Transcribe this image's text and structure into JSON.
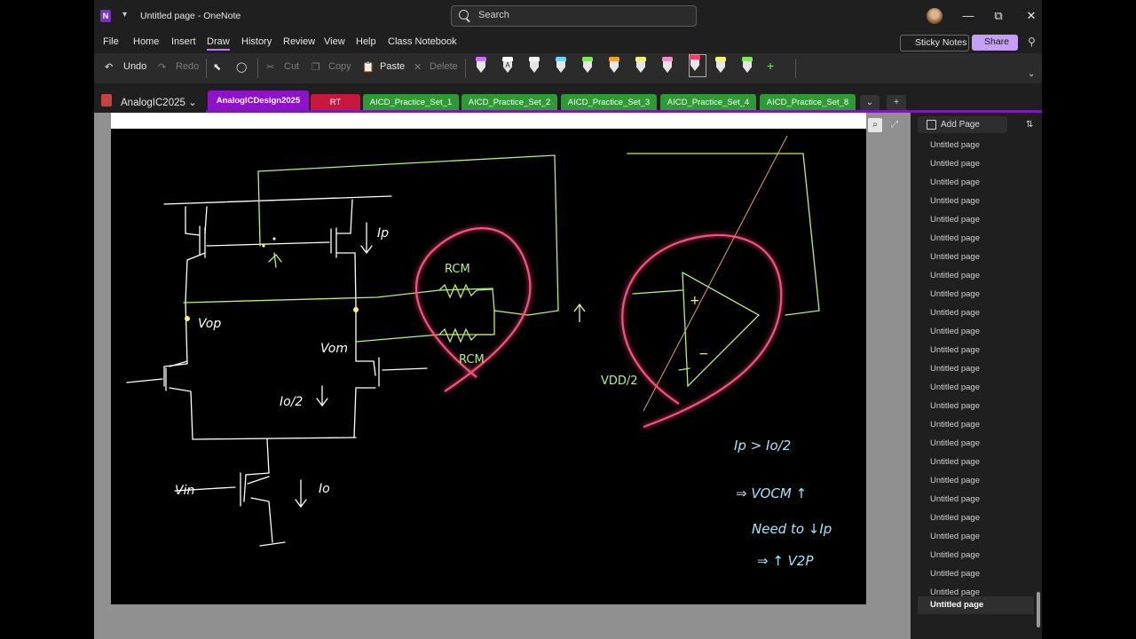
{
  "title_bar": {
    "app_icon_letter": "N",
    "document_title": "Untitled page  -  OneNote",
    "search_placeholder": "Search",
    "minimize": "—",
    "restore": "⧉",
    "close": "✕"
  },
  "menu": {
    "items": [
      "File",
      "Home",
      "Insert",
      "Draw",
      "History",
      "Review",
      "View",
      "Help",
      "Class Notebook"
    ],
    "active": "Draw",
    "sticky_notes": "Sticky Notes",
    "share": "Share"
  },
  "ribbon": {
    "undo": "Undo",
    "redo": "Redo",
    "cut": "Cut",
    "copy": "Copy",
    "paste": "Paste",
    "delete": "Delete",
    "pens": [
      {
        "color": "#c774ff"
      },
      {
        "color": "#ffffff",
        "letter": "A"
      },
      {
        "color": "#ffffff"
      },
      {
        "color": "#6fd7f5"
      },
      {
        "color": "#7be85a"
      },
      {
        "color": "#f0a030"
      },
      {
        "color": "#f5f27a"
      },
      {
        "color": "#f78bd0"
      },
      {
        "color": "#ff3b6a",
        "selected": true
      },
      {
        "color": "#f5f27a"
      },
      {
        "color": "#7be85a"
      }
    ],
    "add_pen": "+"
  },
  "notebook": {
    "name": "AnalogIC2025",
    "sections": [
      {
        "label": "AnalogICDesign2025",
        "color": "#8d12c9",
        "active": true
      },
      {
        "label": "RT",
        "color": "#c8173d"
      },
      {
        "label": "AICD_Practice_Set_1",
        "color": "#2e9a33"
      },
      {
        "label": "AICD_Practice_Set_2",
        "color": "#2e9a33"
      },
      {
        "label": "AICD_Practice_Set_3",
        "color": "#2e9a33"
      },
      {
        "label": "AICD_Practice_Set_4",
        "color": "#2e9a33"
      },
      {
        "label": "AICD_Practice_Set_8",
        "color": "#2e9a33"
      }
    ],
    "add_section": "+"
  },
  "pages": {
    "add_page": "Add Page",
    "items": [
      "Untitled page",
      "Untitled page",
      "Untitled page",
      "Untitled page",
      "Untitled page",
      "Untitled page",
      "Untitled page",
      "Untitled page",
      "Untitled page",
      "Untitled page",
      "Untitled page",
      "Untitled page",
      "Untitled page",
      "Untitled page",
      "Untitled page",
      "Untitled page",
      "Untitled page",
      "Untitled page",
      "Untitled page",
      "Untitled page",
      "Untitled page",
      "Untitled page",
      "Untitled page",
      "Untitled page",
      "Untitled page",
      "Untitled page"
    ],
    "current": "Untitled page"
  },
  "ink": {
    "ip": "Ip",
    "vop": "Vop",
    "vom": "Vom",
    "rcm_top": "RCM",
    "rcm_bottom": "RCM",
    "io_half": "Io/2",
    "vin": "Vin",
    "io": "Io",
    "vdd_half": "VDD/2",
    "opamp_plus": "+",
    "opamp_minus": "−",
    "note_1": "Ip > Io/2",
    "note_2": "⇒ VOCM ↑",
    "note_3": "Need to ↓Ip",
    "note_4": "⇒ ↑ V2P"
  },
  "colors": {
    "ink_white": "#ffffff",
    "ink_green": "#b7f26a",
    "ink_yellow": "#f5f27a",
    "ink_pink": "#ff4f7e",
    "ink_cyan": "#9fe6ff",
    "ink_orange": "#e8a05a"
  }
}
